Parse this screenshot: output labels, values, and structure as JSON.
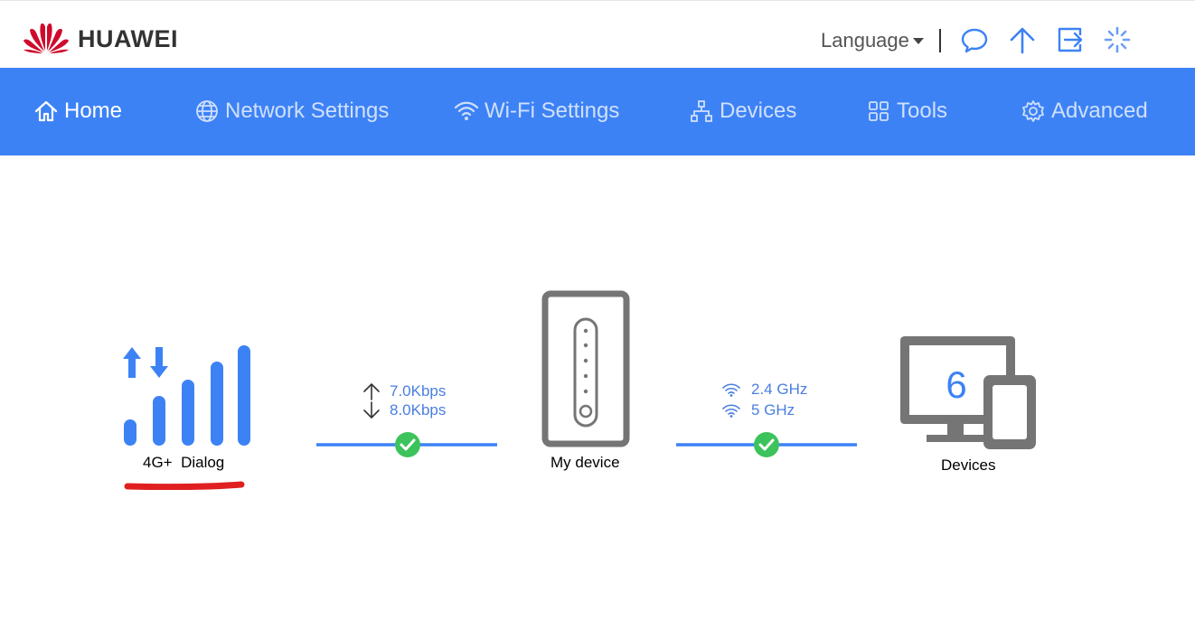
{
  "header": {
    "brand": "HUAWEI",
    "language_label": "Language",
    "icons": [
      "chat-icon",
      "upload-icon",
      "logout-icon",
      "loading-icon"
    ]
  },
  "nav": {
    "items": [
      {
        "label": "Home",
        "icon": "home-icon",
        "active": true
      },
      {
        "label": "Network Settings",
        "icon": "globe-icon",
        "active": false
      },
      {
        "label": "Wi-Fi Settings",
        "icon": "wifi-icon",
        "active": false
      },
      {
        "label": "Devices",
        "icon": "network-tree-icon",
        "active": false
      },
      {
        "label": "Tools",
        "icon": "grid-icon",
        "active": false
      },
      {
        "label": "Advanced",
        "icon": "gear-icon",
        "active": false
      }
    ]
  },
  "status": {
    "network_type": "4G+",
    "operator": "Dialog",
    "upload_speed": "7.0Kbps",
    "download_speed": "8.0Kbps",
    "device_label": "My device",
    "wifi_bands": [
      "2.4 GHz",
      "5 GHz"
    ],
    "devices_label": "Devices",
    "devices_count": "6"
  },
  "colors": {
    "nav_bg": "#3d82f5",
    "accent_blue": "#3d82f5",
    "ok_green": "#3cc35c",
    "device_gray": "#757575",
    "brand_red": "#cf0a2c",
    "annotation_red": "#e02020"
  }
}
